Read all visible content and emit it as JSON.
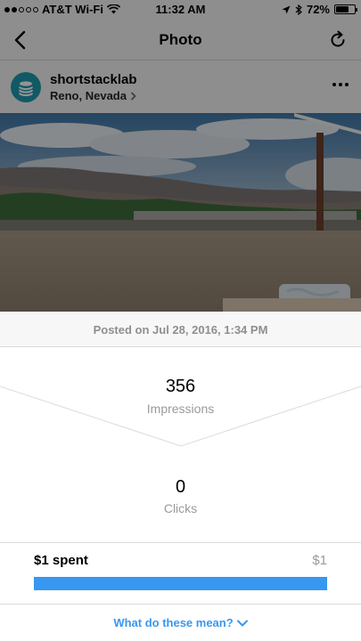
{
  "status_bar": {
    "carrier": "AT&T Wi-Fi",
    "time": "11:32 AM",
    "battery": "72%",
    "battery_level": 0.72,
    "signal_bars": 2
  },
  "nav": {
    "title": "Photo",
    "back_icon": "back-chevron-icon",
    "refresh_icon": "refresh-icon"
  },
  "post": {
    "username": "shortstacklab",
    "location": "Reno, Nevada",
    "posted_on": "Posted on Jul 28, 2016, 1:34 PM"
  },
  "metrics": {
    "impressions_value": "356",
    "impressions_label": "Impressions",
    "clicks_value": "0",
    "clicks_label": "Clicks"
  },
  "spend": {
    "spent": "$1 spent",
    "budget": "$1",
    "progress_fraction": 1.0
  },
  "help": {
    "link_text": "What do these mean?"
  },
  "colors": {
    "accent": "#3897f0",
    "avatar": "#1f9ab0",
    "muted_text": "#9a9a9a"
  }
}
